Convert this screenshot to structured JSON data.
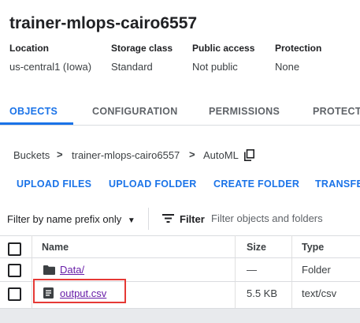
{
  "bucket": {
    "title": "trainer-mlops-cairo6557",
    "meta": {
      "location_label": "Location",
      "location_value": "us-central1 (Iowa)",
      "storage_class_label": "Storage class",
      "storage_class_value": "Standard",
      "public_access_label": "Public access",
      "public_access_value": "Not public",
      "protection_label": "Protection",
      "protection_value": "None"
    }
  },
  "tabs": [
    {
      "label": "OBJECTS",
      "active": true
    },
    {
      "label": "CONFIGURATION",
      "active": false
    },
    {
      "label": "PERMISSIONS",
      "active": false
    },
    {
      "label": "PROTECTI",
      "active": false
    }
  ],
  "breadcrumb": {
    "root": "Buckets",
    "bucket": "trainer-mlops-cairo6557",
    "folder": "AutoML",
    "separator": ">"
  },
  "actions": {
    "upload_files": "UPLOAD FILES",
    "upload_folder": "UPLOAD FOLDER",
    "create_folder": "CREATE FOLDER",
    "transfer": "TRANSFE"
  },
  "filter": {
    "prefix_label": "Filter by name prefix only",
    "filter_label": "Filter",
    "placeholder": "Filter objects and folders"
  },
  "table": {
    "headers": {
      "name": "Name",
      "size": "Size",
      "type": "Type"
    },
    "rows": [
      {
        "name": "Data/",
        "size": "—",
        "type": "Folder",
        "icon": "folder-icon"
      },
      {
        "name": "output.csv",
        "size": "5.5 KB",
        "type": "text/csv",
        "icon": "file-icon"
      }
    ]
  },
  "colors": {
    "accent": "#1a73e8",
    "visited_link": "#681da8",
    "highlight": "#e53935"
  }
}
